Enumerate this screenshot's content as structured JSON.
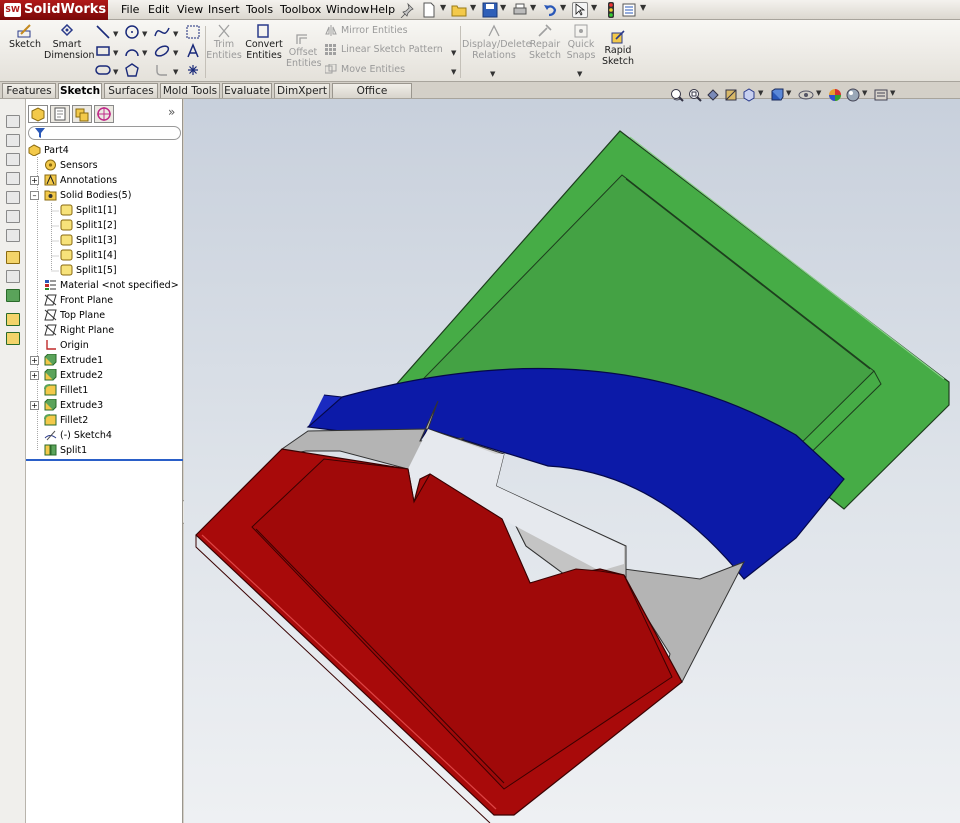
{
  "app": {
    "logo_text": "SolidWorks",
    "badge": "SW"
  },
  "menu": [
    "File",
    "Edit",
    "View",
    "Insert",
    "Tools",
    "Toolbox",
    "Window",
    "Help"
  ],
  "command_manager": {
    "sketch": "Sketch",
    "smart_dimension": [
      "Smart",
      "Dimension"
    ],
    "trim": [
      "Trim",
      "Entities"
    ],
    "convert": [
      "Convert",
      "Entities"
    ],
    "offset": [
      "Offset",
      "Entities"
    ],
    "mirror": "Mirror Entities",
    "linear_pattern": "Linear Sketch Pattern",
    "move": "Move Entities",
    "display_relations": [
      "Display/Delete",
      "Relations"
    ],
    "repair": [
      "Repair",
      "Sketch"
    ],
    "quick_snaps": [
      "Quick",
      "Snaps"
    ],
    "rapid_sketch": [
      "Rapid",
      "Sketch"
    ]
  },
  "tabs": [
    "Features",
    "Sketch",
    "Surfaces",
    "Mold Tools",
    "Evaluate",
    "DimXpert",
    "Office Products"
  ],
  "active_tab": "Sketch",
  "feature_tree": [
    {
      "label": "Part4"
    },
    {
      "label": "Sensors"
    },
    {
      "label": "Annotations"
    },
    {
      "label": "Solid Bodies(5)"
    },
    {
      "label": "Split1[1]"
    },
    {
      "label": "Split1[2]"
    },
    {
      "label": "Split1[3]"
    },
    {
      "label": "Split1[4]"
    },
    {
      "label": "Split1[5]"
    },
    {
      "label": "Material <not specified>"
    },
    {
      "label": "Front Plane"
    },
    {
      "label": "Top Plane"
    },
    {
      "label": "Right Plane"
    },
    {
      "label": "Origin"
    },
    {
      "label": "Extrude1"
    },
    {
      "label": "Extrude2"
    },
    {
      "label": "Fillet1"
    },
    {
      "label": "Extrude3"
    },
    {
      "label": "Fillet2"
    },
    {
      "label": "(-) Sketch4"
    },
    {
      "label": "Split1"
    }
  ],
  "fm_expand_symbol": "»",
  "colors": {
    "body_green": "#3fa53f",
    "body_blue": "#0c1aa8",
    "body_gray": "#b4b4b4",
    "body_red": "#a80a0a",
    "rollback_bar": "#2a5fc8"
  }
}
